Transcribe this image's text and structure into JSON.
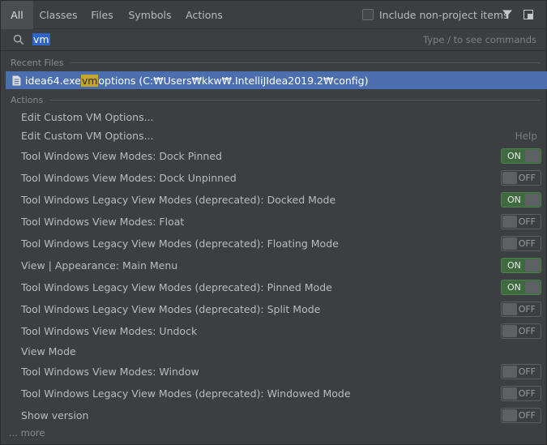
{
  "tabs": [
    "All",
    "Classes",
    "Files",
    "Symbols",
    "Actions"
  ],
  "include_label": "Include non-project items",
  "search": {
    "value": "vm",
    "hint": "Type / to see commands"
  },
  "recent_section": "Recent Files",
  "recent_file": {
    "pre": "idea64.exe",
    "match": "vm",
    "post": "options",
    "path": "(C:₩Users₩kkw₩.IntelliJIdea2019.2₩config)"
  },
  "actions_section": "Actions",
  "help_label": "Help",
  "actions": [
    {
      "label": "Edit Custom VM Options...",
      "toggle": null,
      "help": false
    },
    {
      "label": "Edit Custom VM Options...",
      "toggle": null,
      "help": true
    },
    {
      "label": "Tool Windows View Modes: Dock Pinned",
      "toggle": "ON"
    },
    {
      "label": "Tool Windows View Modes: Dock Unpinned",
      "toggle": "OFF"
    },
    {
      "label": "Tool Windows Legacy View Modes (deprecated): Docked Mode",
      "toggle": "ON"
    },
    {
      "label": "Tool Windows View Modes: Float",
      "toggle": "OFF"
    },
    {
      "label": "Tool Windows Legacy View Modes (deprecated): Floating Mode",
      "toggle": "OFF"
    },
    {
      "label": "View | Appearance: Main Menu",
      "toggle": "ON"
    },
    {
      "label": "Tool Windows Legacy View Modes (deprecated): Pinned Mode",
      "toggle": "ON"
    },
    {
      "label": "Tool Windows Legacy View Modes (deprecated): Split Mode",
      "toggle": "OFF"
    },
    {
      "label": "Tool Windows View Modes: Undock",
      "toggle": "OFF"
    },
    {
      "label": "View Mode",
      "toggle": null
    },
    {
      "label": "Tool Windows View Modes: Window",
      "toggle": "OFF"
    },
    {
      "label": "Tool Windows Legacy View Modes (deprecated): Windowed Mode",
      "toggle": "OFF"
    },
    {
      "label": "Show version",
      "toggle": "OFF"
    }
  ],
  "more_label": "... more",
  "colors": {
    "selection": "#4b6eaf",
    "match_highlight": "#c6a52e",
    "toggle_on": "#3f6a3f"
  }
}
